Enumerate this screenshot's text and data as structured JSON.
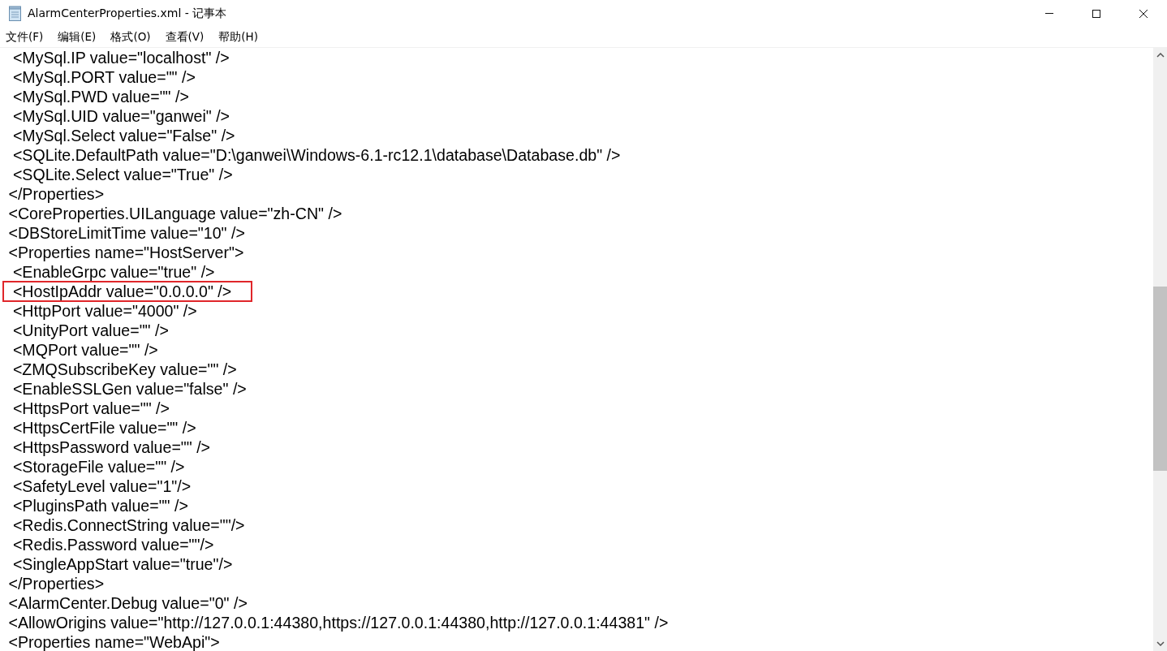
{
  "window": {
    "title": "AlarmCenterProperties.xml - 记事本"
  },
  "menu": [
    "文件(F)",
    "编辑(E)",
    "格式(O)",
    "查看(V)",
    "帮助(H)"
  ],
  "editor": {
    "lines": [
      {
        "text": "  <MySql.IP value=\"localhost\" />",
        "highlighted": false
      },
      {
        "text": "  <MySql.PORT value=\"\" />",
        "highlighted": false
      },
      {
        "text": "  <MySql.PWD value=\"\" />",
        "highlighted": false
      },
      {
        "text": "  <MySql.UID value=\"ganwei\" />",
        "highlighted": false
      },
      {
        "text": "  <MySql.Select value=\"False\" />",
        "highlighted": false
      },
      {
        "text": "  <SQLite.DefaultPath value=\"D:\\ganwei\\Windows-6.1-rc12.1\\database\\Database.db\" />",
        "highlighted": false
      },
      {
        "text": "  <SQLite.Select value=\"True\" />",
        "highlighted": false
      },
      {
        "text": " </Properties>",
        "highlighted": false
      },
      {
        "text": " <CoreProperties.UILanguage value=\"zh-CN\" />",
        "highlighted": false
      },
      {
        "text": " <DBStoreLimitTime value=\"10\" />",
        "highlighted": false
      },
      {
        "text": " <Properties name=\"HostServer\">",
        "highlighted": false
      },
      {
        "text": "  <EnableGrpc value=\"true\" />",
        "highlighted": false
      },
      {
        "text": "  <HostIpAddr value=\"0.0.0.0\" />",
        "highlighted": true
      },
      {
        "text": "  <HttpPort value=\"4000\" />",
        "highlighted": false
      },
      {
        "text": "  <UnityPort value=\"\" />",
        "highlighted": false
      },
      {
        "text": "  <MQPort value=\"\" />",
        "highlighted": false
      },
      {
        "text": "  <ZMQSubscribeKey value=\"\" />",
        "highlighted": false
      },
      {
        "text": "  <EnableSSLGen value=\"false\" />",
        "highlighted": false
      },
      {
        "text": "  <HttpsPort value=\"\" />",
        "highlighted": false
      },
      {
        "text": "  <HttpsCertFile value=\"\" />",
        "highlighted": false
      },
      {
        "text": "  <HttpsPassword value=\"\" />",
        "highlighted": false
      },
      {
        "text": "  <StorageFile value=\"\" />",
        "highlighted": false
      },
      {
        "text": "  <SafetyLevel value=\"1\"/>",
        "highlighted": false
      },
      {
        "text": "  <PluginsPath value=\"\" />",
        "highlighted": false
      },
      {
        "text": "  <Redis.ConnectString value=\"\"/>",
        "highlighted": false
      },
      {
        "text": "  <Redis.Password value=\"\"/>",
        "highlighted": false
      },
      {
        "text": "  <SingleAppStart value=\"true\"/>",
        "highlighted": false
      },
      {
        "text": " </Properties>",
        "highlighted": false
      },
      {
        "text": " <AlarmCenter.Debug value=\"0\" />",
        "highlighted": false
      },
      {
        "text": " <AllowOrigins value=\"http://127.0.0.1:44380,https://127.0.0.1:44380,http://127.0.0.1:44381\" />",
        "highlighted": false
      },
      {
        "text": " <Properties name=\"WebApi\">",
        "highlighted": false
      }
    ]
  }
}
